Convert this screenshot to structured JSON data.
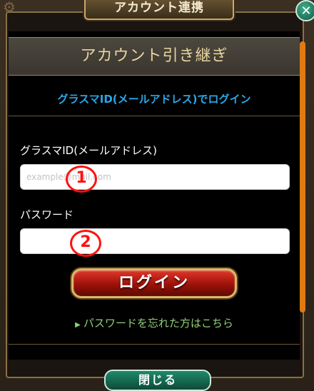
{
  "dialog": {
    "title": "アカウント連携",
    "close_glyph": "✕"
  },
  "panel": {
    "header": "アカウント引き継ぎ",
    "login_heading": "グラスマID(メールアドレス)でログイン",
    "id_label": "グラスマID(メールアドレス)",
    "id_placeholder": "example@mail.com",
    "password_label": "パスワード",
    "login_button": "ログイン",
    "forgot_link": "パスワードを忘れた方はこちら"
  },
  "annotations": {
    "mark_1": "1",
    "mark_2": "2"
  },
  "footer": {
    "close_button": "閉じる"
  },
  "colors": {
    "heading_blue": "#29a7e6",
    "link_green": "#8fd07a",
    "header_gold": "#e8d59e",
    "scrollbar_orange": "#e07a12",
    "annotation_red": "#ff1010"
  },
  "icons": {
    "gear": "gear-icon",
    "close": "close-icon",
    "forgot_arrow": "triangle-right-icon"
  }
}
